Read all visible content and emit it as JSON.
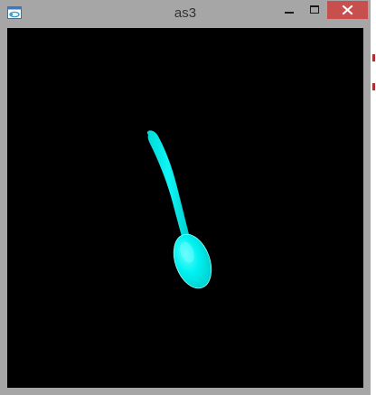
{
  "window": {
    "title": "as3",
    "icon": "app-window-icon",
    "controls": {
      "minimize_icon": "minimize-icon",
      "maximize_icon": "maximize-icon",
      "close_icon": "close-icon"
    }
  },
  "viewport": {
    "background": "#000000",
    "object": "spoon",
    "object_color": "#00f0f0"
  },
  "colors": {
    "frame": "#a6a6a6",
    "close_button": "#c7504f",
    "title_text": "#333333"
  }
}
